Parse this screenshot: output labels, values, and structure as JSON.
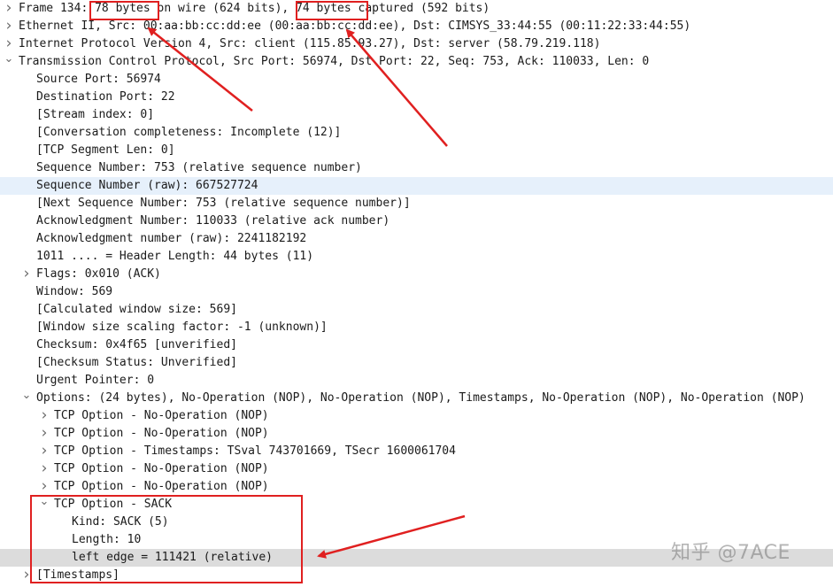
{
  "tree": [
    {
      "level": 0,
      "expander": "collapsed",
      "text": "Frame 134: 78 bytes on wire (624 bits), 74 bytes captured (592 bits)"
    },
    {
      "level": 0,
      "expander": "collapsed",
      "text": "Ethernet II, Src: 00:aa:bb:cc:dd:ee (00:aa:bb:cc:dd:ee), Dst: CIMSYS_33:44:55 (00:11:22:33:44:55)"
    },
    {
      "level": 0,
      "expander": "collapsed",
      "text": "Internet Protocol Version 4, Src: client (115.85.93.27), Dst: server (58.79.219.118)"
    },
    {
      "level": 0,
      "expander": "expanded",
      "text": "Transmission Control Protocol, Src Port: 56974, Dst Port: 22, Seq: 753, Ack: 110033, Len: 0"
    },
    {
      "level": 1,
      "expander": "none",
      "text": "Source Port: 56974"
    },
    {
      "level": 1,
      "expander": "none",
      "text": "Destination Port: 22"
    },
    {
      "level": 1,
      "expander": "none",
      "text": "[Stream index: 0]"
    },
    {
      "level": 1,
      "expander": "none",
      "text": "[Conversation completeness: Incomplete (12)]"
    },
    {
      "level": 1,
      "expander": "none",
      "text": "[TCP Segment Len: 0]"
    },
    {
      "level": 1,
      "expander": "none",
      "text": "Sequence Number: 753    (relative sequence number)"
    },
    {
      "level": 1,
      "expander": "none",
      "text": "Sequence Number (raw): 667527724",
      "highlight": "light"
    },
    {
      "level": 1,
      "expander": "none",
      "text": "[Next Sequence Number: 753    (relative sequence number)]"
    },
    {
      "level": 1,
      "expander": "none",
      "text": "Acknowledgment Number: 110033    (relative ack number)"
    },
    {
      "level": 1,
      "expander": "none",
      "text": "Acknowledgment number (raw): 2241182192"
    },
    {
      "level": 1,
      "expander": "none",
      "text": "1011 .... = Header Length: 44 bytes (11)"
    },
    {
      "level": 1,
      "expander": "collapsed",
      "text": "Flags: 0x010 (ACK)"
    },
    {
      "level": 1,
      "expander": "none",
      "text": "Window: 569"
    },
    {
      "level": 1,
      "expander": "none",
      "text": "[Calculated window size: 569]"
    },
    {
      "level": 1,
      "expander": "none",
      "text": "[Window size scaling factor: -1 (unknown)]"
    },
    {
      "level": 1,
      "expander": "none",
      "text": "Checksum: 0x4f65 [unverified]"
    },
    {
      "level": 1,
      "expander": "none",
      "text": "[Checksum Status: Unverified]"
    },
    {
      "level": 1,
      "expander": "none",
      "text": "Urgent Pointer: 0"
    },
    {
      "level": 1,
      "expander": "expanded",
      "text": "Options: (24 bytes), No-Operation (NOP), No-Operation (NOP), Timestamps, No-Operation (NOP), No-Operation (NOP)"
    },
    {
      "level": 2,
      "expander": "collapsed",
      "text": "TCP Option - No-Operation (NOP)"
    },
    {
      "level": 2,
      "expander": "collapsed",
      "text": "TCP Option - No-Operation (NOP)"
    },
    {
      "level": 2,
      "expander": "collapsed",
      "text": "TCP Option - Timestamps: TSval 743701669, TSecr 1600061704"
    },
    {
      "level": 2,
      "expander": "collapsed",
      "text": "TCP Option - No-Operation (NOP)"
    },
    {
      "level": 2,
      "expander": "collapsed",
      "text": "TCP Option - No-Operation (NOP)"
    },
    {
      "level": 2,
      "expander": "expanded",
      "text": "TCP Option - SACK"
    },
    {
      "level": 3,
      "expander": "none",
      "text": "Kind: SACK (5)"
    },
    {
      "level": 3,
      "expander": "none",
      "text": "Length: 10"
    },
    {
      "level": 3,
      "expander": "none",
      "text": "left edge = 111421 (relative)",
      "highlight": "gray"
    },
    {
      "level": 1,
      "expander": "collapsed",
      "text": "[Timestamps]"
    }
  ],
  "icons": {
    "collapsed": "chevron-right-icon",
    "expanded": "chevron-down-icon"
  },
  "annotation_color": "#e02020",
  "watermark": "知乎 @7ACE"
}
